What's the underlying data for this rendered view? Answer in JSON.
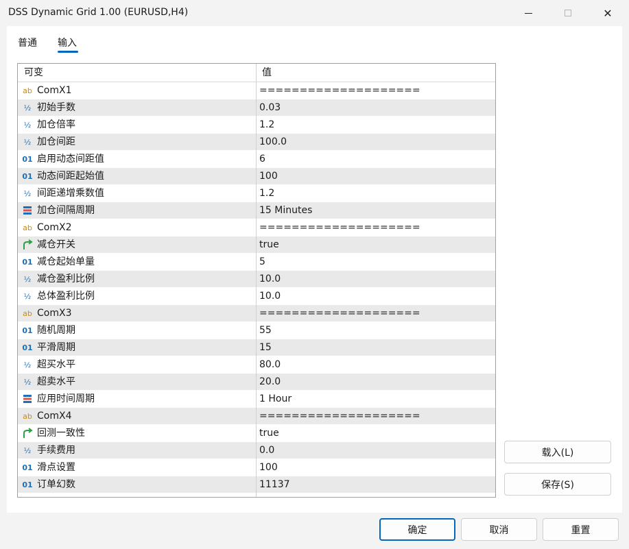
{
  "window": {
    "title": "DSS Dynamic Grid 1.00 (EURUSD,H4)",
    "close_glyph": "✕"
  },
  "tabs": [
    {
      "label": "普通"
    },
    {
      "label": "输入"
    }
  ],
  "grid": {
    "header": {
      "variable": "可变",
      "value": "值"
    },
    "rows": [
      {
        "icon": "ab-icon",
        "icon_glyph": "ab",
        "name": "ComX1",
        "value": "===================="
      },
      {
        "icon": "fraction-icon",
        "icon_glyph": "½",
        "name": "初始手数",
        "value": "0.03"
      },
      {
        "icon": "fraction-icon",
        "icon_glyph": "½",
        "name": "加仓倍率",
        "value": "1.2"
      },
      {
        "icon": "fraction-icon",
        "icon_glyph": "½",
        "name": "加仓间距",
        "value": "100.0"
      },
      {
        "icon": "integer-icon",
        "icon_glyph": "01",
        "name": "启用动态间距值",
        "value": "6"
      },
      {
        "icon": "integer-icon",
        "icon_glyph": "01",
        "name": "动态间距起始值",
        "value": "100"
      },
      {
        "icon": "fraction-icon",
        "icon_glyph": "½",
        "name": "间距递增乘数值",
        "value": "1.2"
      },
      {
        "icon": "enum-icon",
        "icon_glyph": "",
        "name": "加仓间隔周期",
        "value": "15 Minutes"
      },
      {
        "icon": "ab-icon",
        "icon_glyph": "ab",
        "name": "ComX2",
        "value": "===================="
      },
      {
        "icon": "bool-icon",
        "icon_glyph": "",
        "name": "减仓开关",
        "value": "true"
      },
      {
        "icon": "integer-icon",
        "icon_glyph": "01",
        "name": "减仓起始单量",
        "value": "5"
      },
      {
        "icon": "fraction-icon",
        "icon_glyph": "½",
        "name": "减仓盈利比例",
        "value": "10.0"
      },
      {
        "icon": "fraction-icon",
        "icon_glyph": "½",
        "name": "总体盈利比例",
        "value": "10.0"
      },
      {
        "icon": "ab-icon",
        "icon_glyph": "ab",
        "name": "ComX3",
        "value": "===================="
      },
      {
        "icon": "integer-icon",
        "icon_glyph": "01",
        "name": "随机周期",
        "value": "55"
      },
      {
        "icon": "integer-icon",
        "icon_glyph": "01",
        "name": "平滑周期",
        "value": "15"
      },
      {
        "icon": "fraction-icon",
        "icon_glyph": "½",
        "name": "超买水平",
        "value": "80.0"
      },
      {
        "icon": "fraction-icon",
        "icon_glyph": "½",
        "name": "超卖水平",
        "value": "20.0"
      },
      {
        "icon": "enum-icon",
        "icon_glyph": "",
        "name": "应用时间周期",
        "value": "1 Hour"
      },
      {
        "icon": "ab-icon",
        "icon_glyph": "ab",
        "name": "ComX4",
        "value": "===================="
      },
      {
        "icon": "bool-icon",
        "icon_glyph": "",
        "name": "回测一致性",
        "value": "true"
      },
      {
        "icon": "fraction-icon",
        "icon_glyph": "½",
        "name": "手续费用",
        "value": "0.0"
      },
      {
        "icon": "integer-icon",
        "icon_glyph": "01",
        "name": "滑点设置",
        "value": "100"
      },
      {
        "icon": "integer-icon",
        "icon_glyph": "01",
        "name": "订单幻数",
        "value": "11137"
      }
    ]
  },
  "buttons": {
    "load": "载入(L)",
    "save": "保存(S)",
    "ok": "确定",
    "cancel": "取消",
    "reset": "重置"
  },
  "colors": {
    "accent": "#0067c0",
    "row_alt": "#e9e9e9",
    "icon_string": "#c98a1a",
    "icon_number": "#1d6fb8",
    "icon_bool": "#2ea043"
  }
}
